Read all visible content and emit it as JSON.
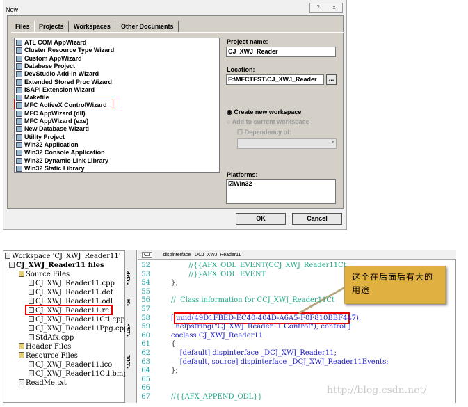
{
  "dialog": {
    "title": "New",
    "help_icon": "?",
    "close_icon": "x",
    "tabs": [
      "Files",
      "Projects",
      "Workspaces",
      "Other Documents"
    ],
    "active_tab": "Projects",
    "project_types": [
      "ATL COM AppWizard",
      "Cluster Resource Type Wizard",
      "Custom AppWizard",
      "Database Project",
      "DevStudio Add-in Wizard",
      "Extended Stored Proc Wizard",
      "ISAPI Extension Wizard",
      "Makefile",
      "MFC ActiveX ControlWizard",
      "MFC AppWizard (dll)",
      "MFC AppWizard (exe)",
      "New Database Wizard",
      "Utility Project",
      "Win32 Application",
      "Win32 Console Application",
      "Win32 Dynamic-Link Library",
      "Win32 Static Library"
    ],
    "selected": "MFC ActiveX ControlWizard",
    "project_name_label": "Project name:",
    "project_name": "CJ_XWJ_Reader",
    "location_label": "Location:",
    "location": "F:\\MFCTEST\\CJ_XWJ_Reader",
    "browse": "...",
    "create_new": "Create new workspace",
    "add_current": "Add to current workspace",
    "dependency": "Dependency of:",
    "platforms_label": "Platforms:",
    "platform": "Win32",
    "ok": "OK",
    "cancel": "Cancel"
  },
  "tree": {
    "workspace": "Workspace 'CJ_XWJ_Reader11'",
    "project": "CJ_XWJ_Reader11 files",
    "source": "Source Files",
    "source_files": [
      "CJ_XWJ_Reader11.cpp",
      "CJ_XWJ_Reader11.def",
      "CJ_XWJ_Reader11.odl",
      "CJ_XWJ_Reader11.rc",
      "CJ_XWJ_Reader11Ctl.cpp",
      "CJ_XWJ_Reader11Ppg.cpp",
      "StdAfx.cpp"
    ],
    "header": "Header Files",
    "resource": "Resource Files",
    "resource_files": [
      "CJ_XWJ_Reader11.ico",
      "CJ_XWJ_Reader11Ctl.bmp"
    ],
    "readme": "ReadMe.txt"
  },
  "file_tabs": [
    "*.ODL",
    "*.DEF",
    "*.H",
    "*.CPP"
  ],
  "editor": {
    "class_combo": "CJ",
    "member_combo": "dispinterface _DCJ_XWJ_Reader11",
    "lines": [
      {
        "n": "52",
        "t": "        //{{AFX_ODL_EVENT(CCJ_XWJ_Reader11Ct",
        "c": "g"
      },
      {
        "n": "53",
        "t": "        //}}AFX_ODL_EVENT",
        "c": "g"
      },
      {
        "n": "54",
        "t": "};",
        "c": "k"
      },
      {
        "n": "55",
        "t": "",
        "c": "k"
      },
      {
        "n": "56",
        "t": "//  Class information for CCJ_XWJ_Reader11Ct",
        "c": "g"
      },
      {
        "n": "57",
        "t": "",
        "c": "k"
      },
      {
        "n": "58",
        "t": "[ uuid(49D1FBED-EC40-404D-A6A5-F0F810BBF447),",
        "c": "b"
      },
      {
        "n": "59",
        "t": "  helpstring(\"CJ_XWJ_Reader11 Control\"), control ]",
        "c": "b"
      },
      {
        "n": "60",
        "t": "coclass CJ_XWJ_Reader11",
        "c": "b"
      },
      {
        "n": "61",
        "t": "{",
        "c": "k"
      },
      {
        "n": "62",
        "t": "    [default] dispinterface _DCJ_XWJ_Reader11;",
        "c": "b"
      },
      {
        "n": "63",
        "t": "    [default, source] dispinterface _DCJ_XWJ_Reader11Events;",
        "c": "b"
      },
      {
        "n": "64",
        "t": "};",
        "c": "k"
      },
      {
        "n": "65",
        "t": "",
        "c": "k"
      },
      {
        "n": "66",
        "t": "",
        "c": "k"
      },
      {
        "n": "67",
        "t": "//{{AFX_APPEND_ODL}}",
        "c": "g"
      }
    ]
  },
  "callout": "这个在后面后有大的用途",
  "watermark": "http://blog.csdn.net/"
}
